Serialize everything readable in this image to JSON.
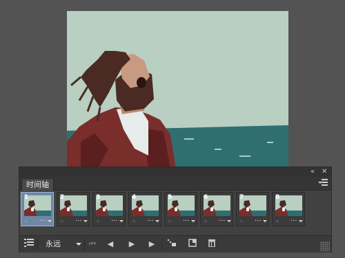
{
  "panel": {
    "tab_label": "时间轴",
    "collapse_icon": "double-chevron-left-icon",
    "close_icon": "close-icon",
    "menu_icon": "panel-menu-icon"
  },
  "frames": [
    {
      "number": "1",
      "delay": "...",
      "selected": true
    },
    {
      "number": "2",
      "delay": "...",
      "selected": false
    },
    {
      "number": "3",
      "delay": "...",
      "selected": false
    },
    {
      "number": "4",
      "delay": "...",
      "selected": false
    },
    {
      "number": "5",
      "delay": "...",
      "selected": false
    },
    {
      "number": "6",
      "delay": "...",
      "selected": false
    },
    {
      "number": "7",
      "delay": "...",
      "selected": false
    },
    {
      "number": "8",
      "delay": "...",
      "selected": false
    }
  ],
  "toolbar": {
    "convert_icon": "convert-to-video-timeline-icon",
    "loop_value": "永远",
    "first_frame_icon": "first-frame-icon",
    "prev_frame_icon": "previous-frame-icon",
    "play_icon": "play-icon",
    "next_frame_icon": "next-frame-icon",
    "tween_icon": "tween-icon",
    "duplicate_icon": "duplicate-frame-icon",
    "delete_icon": "trash-icon"
  },
  "colors": {
    "sky": "#b8cfc2",
    "sea": "#2f6f72",
    "jacket": "#7a2e2c",
    "hair": "#4a2a22",
    "skin": "#c99a82",
    "selected_frame": "#6f86a6"
  }
}
